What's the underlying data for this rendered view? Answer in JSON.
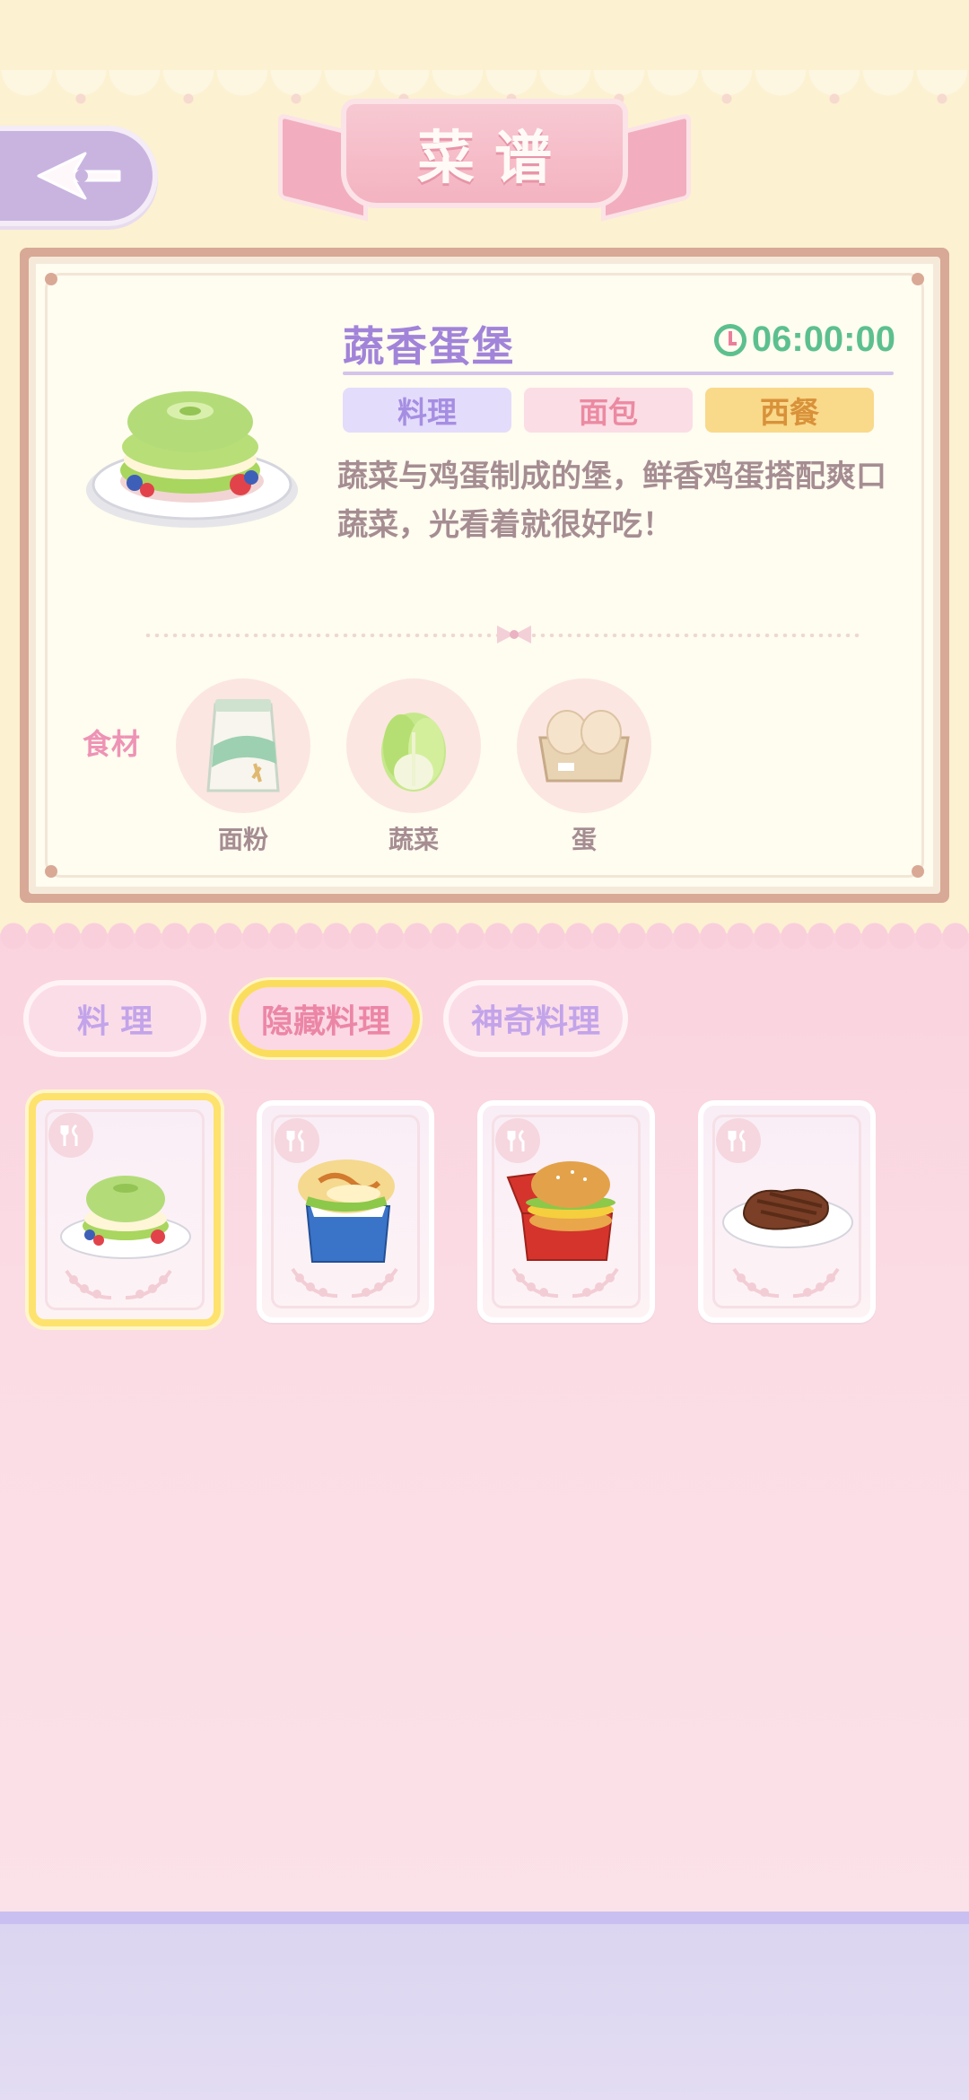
{
  "header": {
    "title": "菜谱"
  },
  "detail": {
    "dish_name": "蔬香蛋堡",
    "timer": "06:00:00",
    "tags": [
      "料理",
      "面包",
      "西餐"
    ],
    "description": "蔬菜与鸡蛋制成的堡，鲜香鸡蛋搭配爽口蔬菜，光看着就很好吃！",
    "ingredients_title": "食材",
    "ingredients": [
      {
        "label": "面粉",
        "icon": "flour-bag-icon"
      },
      {
        "label": "蔬菜",
        "icon": "cabbage-icon"
      },
      {
        "label": "蛋",
        "icon": "egg-carton-icon"
      }
    ]
  },
  "tabs": [
    {
      "label": "料 理",
      "active": false
    },
    {
      "label": "隐藏料理",
      "active": true
    },
    {
      "label": "神奇料理",
      "active": false
    }
  ],
  "recipes": [
    {
      "icon": "green-egg-burger-icon",
      "selected": true
    },
    {
      "icon": "sandwich-box-icon",
      "selected": false
    },
    {
      "icon": "burger-box-icon",
      "selected": false
    },
    {
      "icon": "steak-plate-icon",
      "selected": false
    }
  ],
  "colors": {
    "accent_purple": "#a184d9",
    "timer_green": "#5cc08e",
    "selected_yellow": "#fde26e",
    "pink_bg": "#fbdce5"
  }
}
